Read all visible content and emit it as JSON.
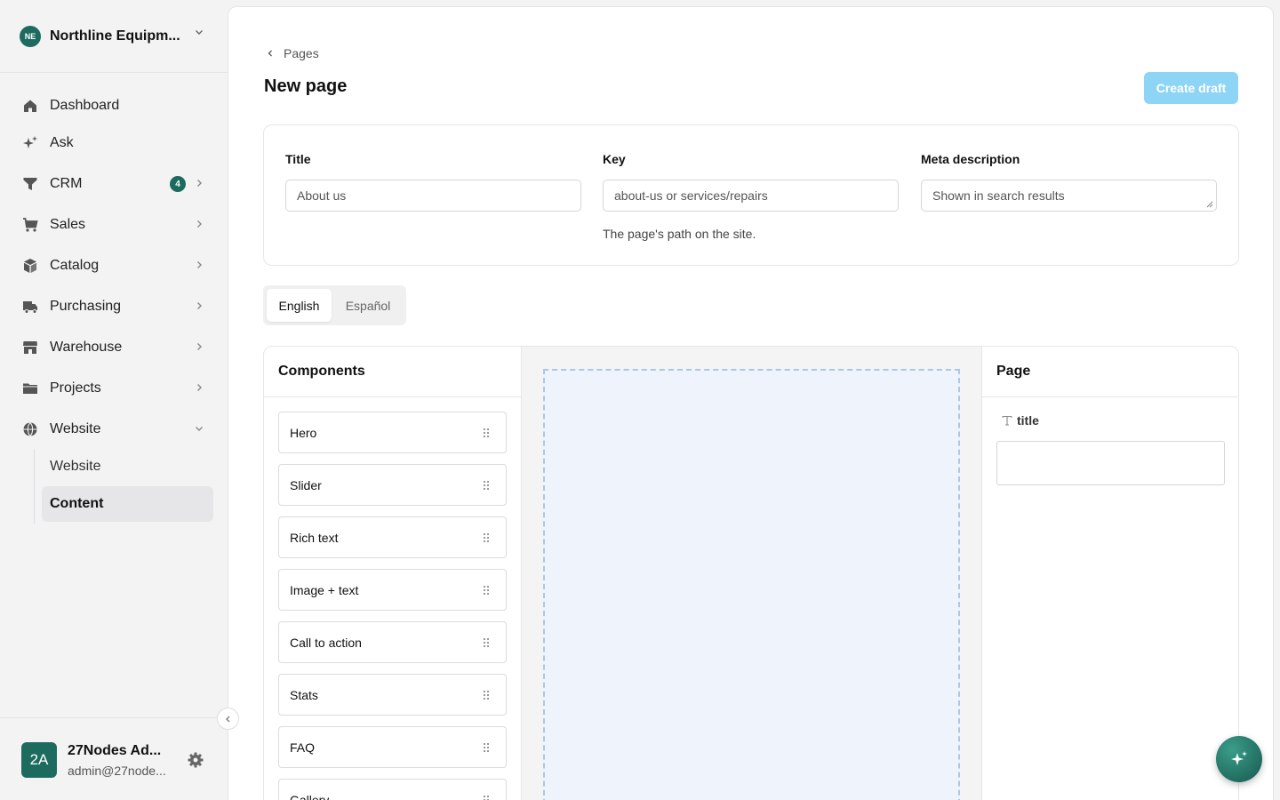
{
  "org": {
    "initials": "NE",
    "name": "Northline Equipm..."
  },
  "nav": {
    "dashboard": "Dashboard",
    "ask": "Ask",
    "crm": "CRM",
    "crm_badge": "4",
    "sales": "Sales",
    "catalog": "Catalog",
    "purchasing": "Purchasing",
    "warehouse": "Warehouse",
    "projects": "Projects",
    "website": "Website",
    "website_sub": [
      "Website",
      "Content"
    ]
  },
  "user": {
    "initials": "2A",
    "name": "27Nodes Ad...",
    "email": "admin@27node..."
  },
  "header": {
    "breadcrumb": "Pages",
    "title": "New page",
    "create_label": "Create draft"
  },
  "form": {
    "title_label": "Title",
    "title_placeholder": "About us",
    "key_label": "Key",
    "key_placeholder": "about-us or services/repairs",
    "key_help": "The page's path on the site.",
    "meta_label": "Meta description",
    "meta_placeholder": "Shown in search results"
  },
  "languages": {
    "active": "English",
    "other": "Español"
  },
  "components": {
    "heading": "Components",
    "items": [
      "Hero",
      "Slider",
      "Rich text",
      "Image + text",
      "Call to action",
      "Stats",
      "FAQ",
      "Gallery"
    ]
  },
  "page_panel": {
    "heading": "Page",
    "field_label": "title"
  },
  "colors": {
    "accent": "#1d6b5e",
    "create_button": "#8dd4f5",
    "drop_zone_border": "#a9c7e6"
  }
}
